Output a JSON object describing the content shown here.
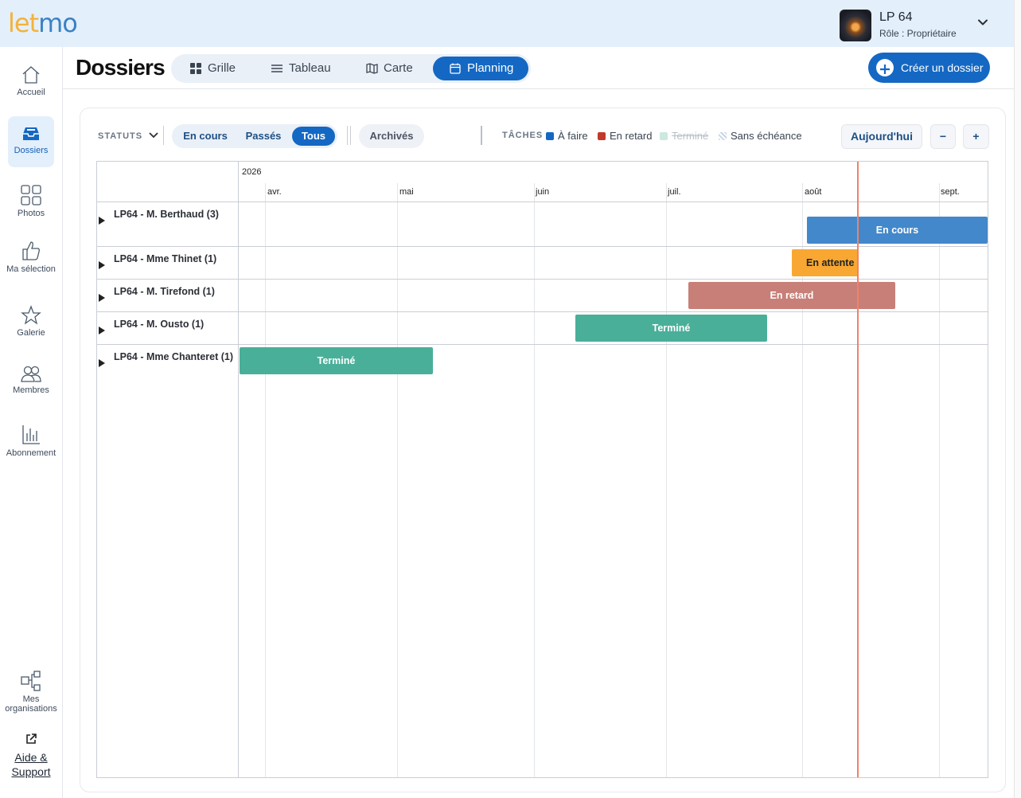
{
  "app": {
    "logo_part1": "let",
    "logo_part2": "mo"
  },
  "profile": {
    "name": "LP 64",
    "role": "Rôle : Propriétaire"
  },
  "sidebar": {
    "items": [
      {
        "label": "Accueil",
        "icon": "home-icon"
      },
      {
        "label": "Dossiers",
        "icon": "inbox-icon",
        "active": true
      },
      {
        "label": "Photos",
        "icon": "grid-icon"
      },
      {
        "label": "Ma sélection",
        "icon": "thumbs-up-icon"
      },
      {
        "label": "Galerie",
        "icon": "star-icon"
      },
      {
        "label": "Membres",
        "icon": "users-icon"
      },
      {
        "label": "Abonnement",
        "icon": "bar-chart-icon"
      }
    ],
    "orgs_label": "Mes organisations",
    "help_label": "Aide & Support"
  },
  "header": {
    "title": "Dossiers",
    "views": [
      {
        "label": "Grille",
        "icon": "grid-icon"
      },
      {
        "label": "Tableau",
        "icon": "list-icon"
      },
      {
        "label": "Carte",
        "icon": "map-icon"
      },
      {
        "label": "Planning",
        "icon": "calendar-icon",
        "active": true
      }
    ],
    "create_label": "Créer un dossier"
  },
  "filters": {
    "statuts_label": "STATUTS",
    "segments": [
      "En cours",
      "Passés",
      "Tous"
    ],
    "selected_segment": "Tous",
    "archives_label": "Archivés",
    "taches_label": "TÂCHES",
    "legend": [
      {
        "label": "À faire",
        "color": "#1468c3"
      },
      {
        "label": "En retard",
        "color": "#c0392b"
      },
      {
        "label": "Terminé",
        "color": "#cde8e0",
        "strikethrough": true
      },
      {
        "label": "Sans échéance",
        "color": "#c7d3e6"
      }
    ],
    "today_label": "Aujourd'hui",
    "zoom_out_label": "−",
    "zoom_in_label": "+"
  },
  "gantt": {
    "year": "2026",
    "months": [
      "avr.",
      "mai",
      "juin",
      "juil.",
      "août",
      "sept."
    ],
    "rows": [
      {
        "label": "LP64 - M. Berthaud (3)",
        "bar_label": "En cours",
        "color": "#4388cb"
      },
      {
        "label": "LP64 - Mme Thinet (1)",
        "bar_label": "En attente",
        "color": "#f8a832"
      },
      {
        "label": "LP64 - M. Tirefond (1)",
        "bar_label": "En retard",
        "color": "#c77f78"
      },
      {
        "label": "LP64 - M. Ousto (1)",
        "bar_label": "Terminé",
        "color": "#4aaf99"
      },
      {
        "label": "LP64 - Mme Chanteret (1)",
        "bar_label": "Terminé",
        "color": "#4aaf99"
      }
    ],
    "today_line_color": "#f0826a"
  }
}
